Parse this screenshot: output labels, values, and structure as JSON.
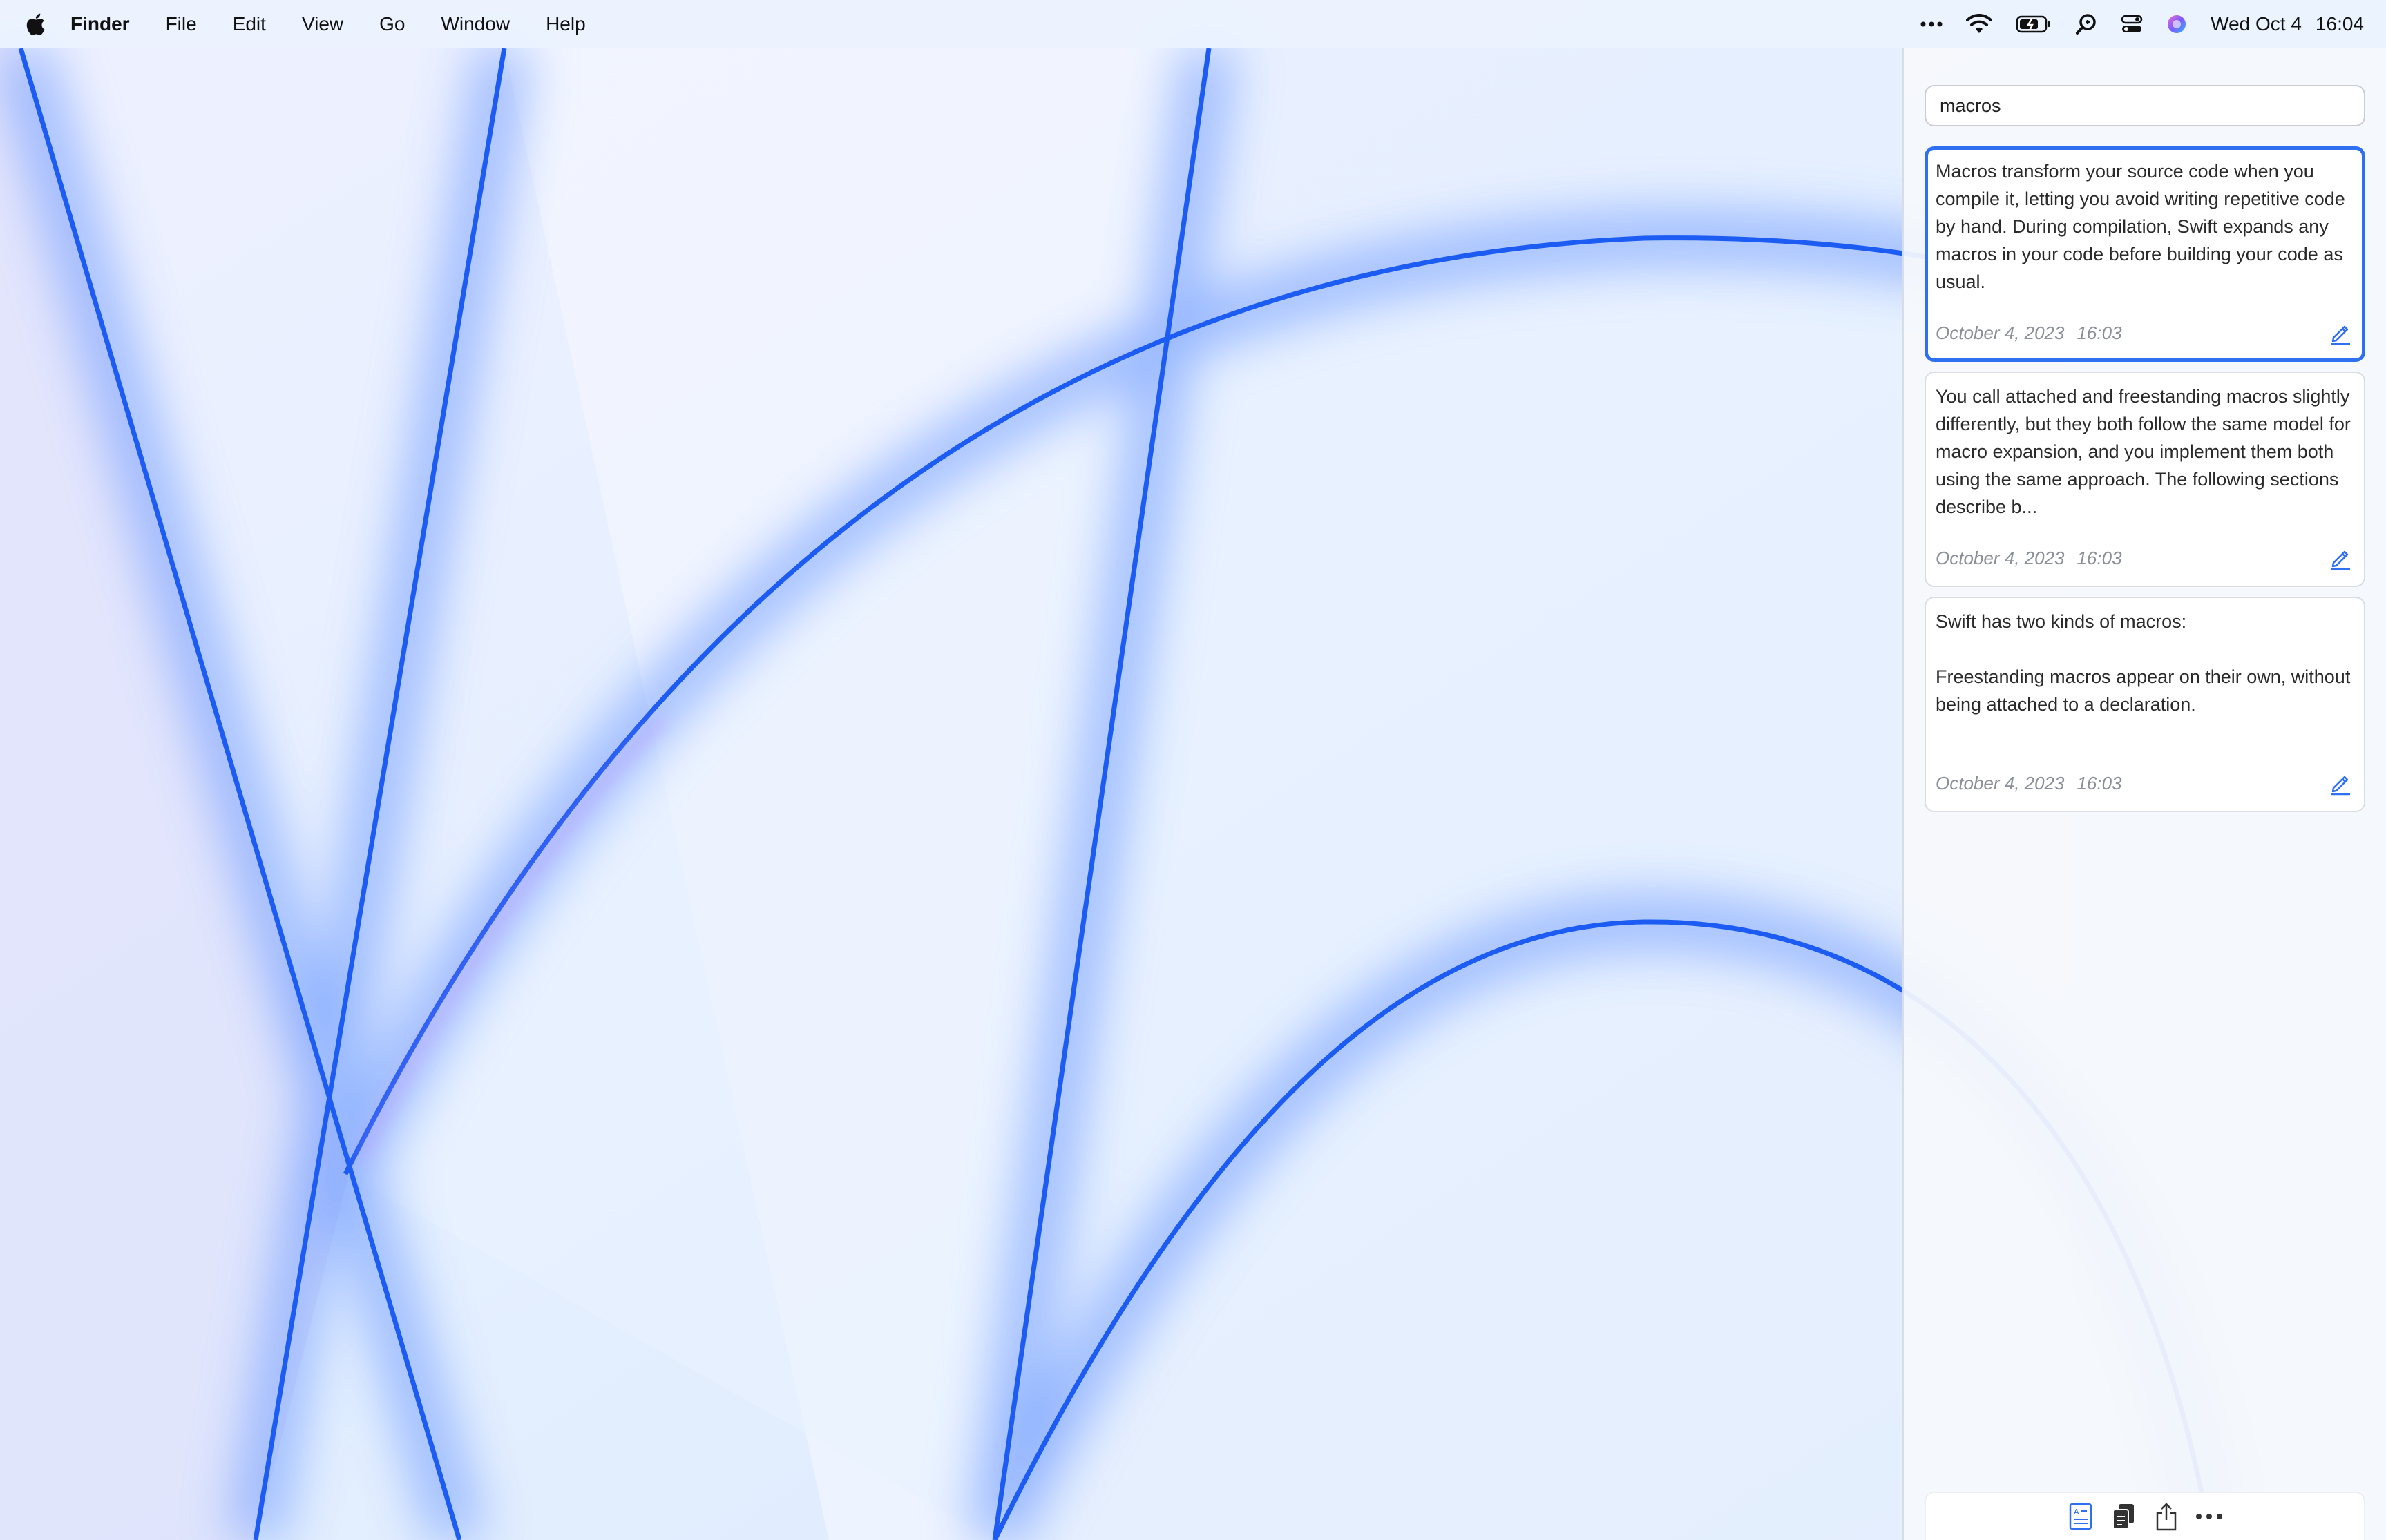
{
  "menubar": {
    "app_name": "Finder",
    "items": [
      "File",
      "Edit",
      "View",
      "Go",
      "Window",
      "Help"
    ],
    "date": "Wed Oct 4",
    "time": "16:04",
    "status_icons": [
      "more-icon",
      "wifi-icon",
      "battery-icon",
      "spotlight-icon",
      "control-center-icon",
      "siri-icon"
    ]
  },
  "panel": {
    "search_value": "macros",
    "notes": [
      {
        "text": "Macros transform your source code when you compile it, letting you avoid writing repetitive code by hand. During compilation, Swift expands any macros in your code before building your code as usual.",
        "date": "October 4, 2023",
        "time": "16:03",
        "selected": true
      },
      {
        "text": "You call attached and freestanding macros slightly differently, but they both follow the same model for macro expansion, and you implement them both using the same approach. The following sections describe b...",
        "date": "October 4, 2023",
        "time": "16:03",
        "selected": false
      },
      {
        "text": "Swift has two kinds of macros:\n\nFreestanding macros appear on their own, without being attached to a declaration.",
        "date": "October 4, 2023",
        "time": "16:03",
        "selected": false
      }
    ],
    "toolbar_icons": [
      "text-recognition-icon",
      "copy-icon",
      "share-icon",
      "more-icon"
    ]
  },
  "colors": {
    "accent": "#2f6ff1",
    "wallpaper_light": "#e6efff",
    "wallpaper_line": "#1f5ff5"
  }
}
